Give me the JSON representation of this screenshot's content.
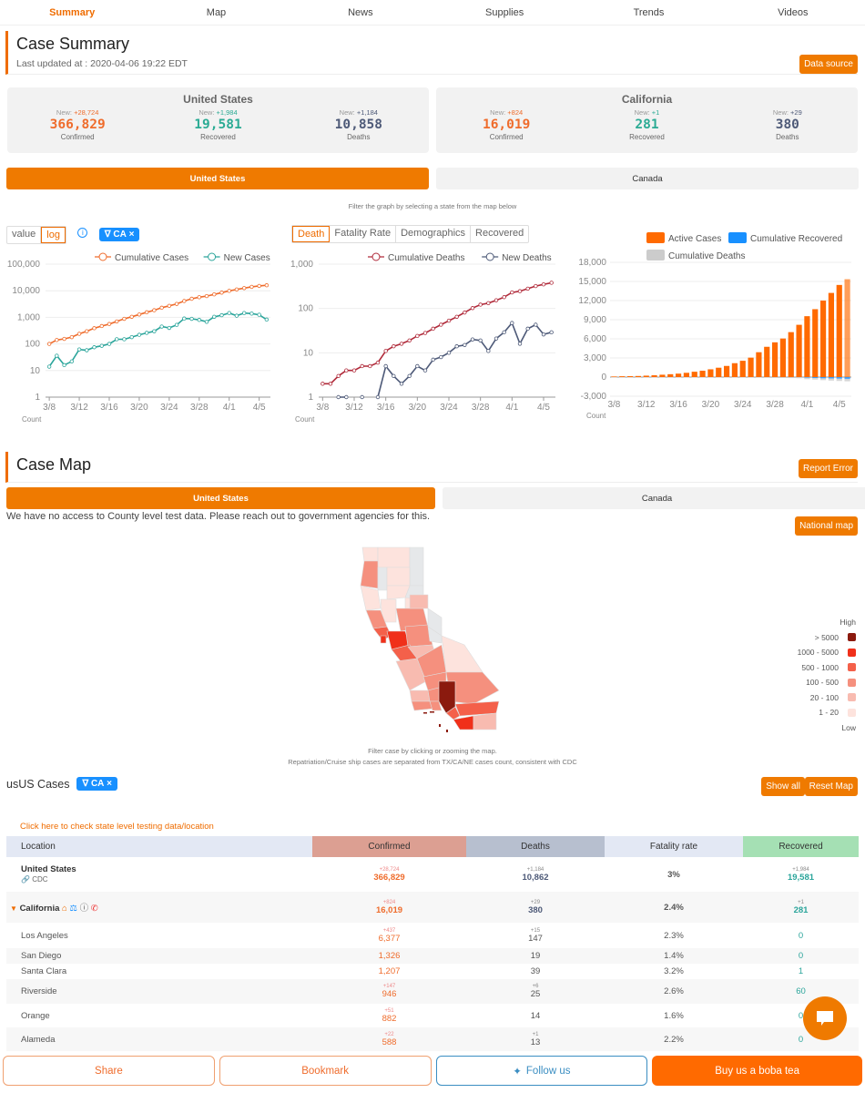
{
  "nav": {
    "tabs": [
      "Summary",
      "Map",
      "News",
      "Supplies",
      "Trends",
      "Videos"
    ],
    "active": "Summary"
  },
  "summary": {
    "title": "Case Summary",
    "last_updated": "Last updated at : 2020-04-06 19:22 EDT",
    "data_source_button": "Data source",
    "cards": [
      {
        "title": "United States",
        "stats": [
          {
            "new": "+28,724",
            "value": "366,829",
            "label": "Confirmed"
          },
          {
            "new": "+1,984",
            "value": "19,581",
            "label": "Recovered"
          },
          {
            "new": "+1,184",
            "value": "10,858",
            "label": "Deaths"
          }
        ]
      },
      {
        "title": "California",
        "stats": [
          {
            "new": "+824",
            "value": "16,019",
            "label": "Confirmed"
          },
          {
            "new": "+1",
            "value": "281",
            "label": "Recovered"
          },
          {
            "new": "+29",
            "value": "380",
            "label": "Deaths"
          }
        ]
      }
    ],
    "new_prefix": "New: "
  },
  "region_toggle": {
    "us": "United States",
    "canada": "Canada"
  },
  "graph_hint": "Filter the graph by selecting a state from the map below",
  "chart_controls": {
    "scale_options": [
      "value",
      "log"
    ],
    "scale_selected": "log",
    "filter_chip": "CA",
    "death_tabs": [
      "Death",
      "Fatality Rate",
      "Demographics",
      "Recovered"
    ],
    "death_tab_selected": "Death"
  },
  "colors": {
    "accent": "#ef7a00",
    "cumCases": "#ef6c2c",
    "newCases": "#2ba59b",
    "cumDeaths": "#b02a3a",
    "newDeaths": "#4e5a78",
    "active": "#ff6a00",
    "recovered": "#1890ff",
    "deaths": "#cccccc"
  },
  "chart_data": [
    {
      "type": "line",
      "title": "",
      "scale": "log",
      "xlabel": "",
      "ylabel": "Count",
      "x": [
        "3/8",
        "3/9",
        "3/10",
        "3/11",
        "3/12",
        "3/13",
        "3/14",
        "3/15",
        "3/16",
        "3/17",
        "3/18",
        "3/19",
        "3/20",
        "3/21",
        "3/22",
        "3/23",
        "3/24",
        "3/25",
        "3/26",
        "3/27",
        "3/28",
        "3/29",
        "3/30",
        "3/31",
        "4/1",
        "4/2",
        "4/3",
        "4/4",
        "4/5",
        "4/6"
      ],
      "xticks": [
        "3/8",
        "3/12",
        "3/16",
        "3/20",
        "3/24",
        "3/28",
        "4/1",
        "4/5"
      ],
      "yticks": [
        "1",
        "10",
        "100",
        "1,000",
        "10,000",
        "100,000"
      ],
      "ylim": [
        1,
        100000
      ],
      "legend": "top-right",
      "series": [
        {
          "name": "Cumulative Cases",
          "values": [
            100,
            140,
            155,
            180,
            240,
            300,
            390,
            470,
            560,
            700,
            880,
            1050,
            1280,
            1550,
            1850,
            2300,
            2700,
            3200,
            4100,
            5000,
            5700,
            6300,
            7300,
            8500,
            9900,
            11200,
            12600,
            14000,
            15200,
            16019
          ]
        },
        {
          "name": "New Cases",
          "values": [
            14,
            36,
            16,
            22,
            62,
            58,
            75,
            85,
            100,
            150,
            150,
            180,
            220,
            260,
            300,
            450,
            400,
            520,
            900,
            880,
            800,
            680,
            1050,
            1200,
            1450,
            1150,
            1450,
            1380,
            1250,
            824
          ]
        }
      ]
    },
    {
      "type": "line",
      "title": "",
      "scale": "log",
      "xlabel": "",
      "ylabel": "Count",
      "x": [
        "3/8",
        "3/9",
        "3/10",
        "3/11",
        "3/12",
        "3/13",
        "3/14",
        "3/15",
        "3/16",
        "3/17",
        "3/18",
        "3/19",
        "3/20",
        "3/21",
        "3/22",
        "3/23",
        "3/24",
        "3/25",
        "3/26",
        "3/27",
        "3/28",
        "3/29",
        "3/30",
        "3/31",
        "4/1",
        "4/2",
        "4/3",
        "4/4",
        "4/5",
        "4/6"
      ],
      "xticks": [
        "3/8",
        "3/12",
        "3/16",
        "3/20",
        "3/24",
        "3/28",
        "4/1",
        "4/5"
      ],
      "yticks": [
        "1",
        "10",
        "100",
        "1,000"
      ],
      "ylim": [
        1,
        1000
      ],
      "legend": "top-right",
      "series": [
        {
          "name": "Cumulative Deaths",
          "values": [
            2,
            2,
            3,
            4,
            4,
            5,
            5,
            6,
            11,
            14,
            16,
            19,
            24,
            28,
            35,
            43,
            53,
            65,
            81,
            102,
            122,
            132,
            153,
            180,
            230,
            245,
            280,
            320,
            350,
            380
          ]
        },
        {
          "name": "New Deaths",
          "values": [
            null,
            null,
            1,
            1,
            null,
            1,
            null,
            1,
            5,
            3,
            2,
            3,
            5,
            4,
            7,
            8,
            10,
            14,
            15,
            20,
            19,
            11,
            21,
            29,
            47,
            16,
            35,
            43,
            26,
            29
          ]
        }
      ]
    },
    {
      "type": "bar",
      "title": "",
      "stacked": true,
      "xlabel": "",
      "ylabel": "Count",
      "categories": [
        "3/8",
        "3/9",
        "3/10",
        "3/11",
        "3/12",
        "3/13",
        "3/14",
        "3/15",
        "3/16",
        "3/17",
        "3/18",
        "3/19",
        "3/20",
        "3/21",
        "3/22",
        "3/23",
        "3/24",
        "3/25",
        "3/26",
        "3/27",
        "3/28",
        "3/29",
        "3/30",
        "3/31",
        "4/1",
        "4/2",
        "4/3",
        "4/4",
        "4/5",
        "4/6"
      ],
      "xticks": [
        "3/8",
        "3/12",
        "3/16",
        "3/20",
        "3/24",
        "3/28",
        "4/1",
        "4/5"
      ],
      "yticks": [
        "-3,000",
        "0",
        "3,000",
        "6,000",
        "9,000",
        "12,000",
        "15,000",
        "18,000"
      ],
      "ylim": [
        -3000,
        18000
      ],
      "legend": "top-right",
      "series": [
        {
          "name": "Active Cases",
          "values": [
            95,
            130,
            145,
            170,
            225,
            285,
            370,
            450,
            540,
            670,
            840,
            1000,
            1220,
            1470,
            1750,
            2180,
            2560,
            3050,
            3900,
            4750,
            5450,
            6050,
            7050,
            8200,
            9550,
            10650,
            12000,
            13200,
            14450,
            15350
          ]
        },
        {
          "name": "Cumulative Recovered",
          "values": [
            0,
            0,
            0,
            0,
            0,
            0,
            0,
            0,
            0,
            0,
            0,
            0,
            0,
            0,
            0,
            0,
            0,
            0,
            0,
            0,
            0,
            0,
            0,
            0,
            -100,
            -150,
            -200,
            -230,
            -260,
            -281
          ]
        },
        {
          "name": "Cumulative Deaths",
          "values": [
            -2,
            -2,
            -3,
            -4,
            -4,
            -5,
            -5,
            -6,
            -11,
            -14,
            -16,
            -19,
            -24,
            -28,
            -35,
            -43,
            -53,
            -65,
            -81,
            -102,
            -122,
            -132,
            -153,
            -180,
            -230,
            -245,
            -280,
            -320,
            -350,
            -380
          ]
        }
      ]
    }
  ],
  "case_map": {
    "title": "Case Map",
    "report_error": "Report Error",
    "national_map": "National map",
    "notice": "We have no access to County level test data. Please reach out to government agencies for this.",
    "legend": {
      "high": "High",
      "low": "Low",
      "ranges": [
        {
          "label": "> 5000",
          "color": "#8b1a0e"
        },
        {
          "label": "1000 - 5000",
          "color": "#f0301a"
        },
        {
          "label": "500 - 1000",
          "color": "#f4604a"
        },
        {
          "label": "100 - 500",
          "color": "#f5907e"
        },
        {
          "label": "20 - 100",
          "color": "#f8bbb0"
        },
        {
          "label": "1 - 20",
          "color": "#fde3dd"
        }
      ]
    },
    "hint1": "Filter case by clicking or zooming the map.",
    "hint2": "Repatriation/Cruise ship cases are separated from TX/CA/NE cases count, consistent with CDC"
  },
  "us_cases": {
    "title": "usUS Cases",
    "chip": "CA",
    "show_all": "Show all",
    "reset_map": "Reset Map",
    "testing_link": "Click here to check state level testing data/location",
    "columns": [
      "Location",
      "Confirmed",
      "Deaths",
      "Fatality rate",
      "Recovered"
    ],
    "rows": [
      {
        "location": "United States",
        "sub": "CDC",
        "confirmed_new": "+28,724",
        "confirmed": "366,829",
        "deaths_new": "+1,184",
        "deaths": "10,862",
        "rate": "3%",
        "recovered_new": "+1,984",
        "recovered": "19,581"
      },
      {
        "location": "California",
        "confirmed_new": "+824",
        "confirmed": "16,019",
        "deaths_new": "+29",
        "deaths": "380",
        "rate": "2.4%",
        "recovered_new": "+1",
        "recovered": "281"
      },
      {
        "location": "Los Angeles",
        "confirmed_new": "+437",
        "confirmed": "6,377",
        "deaths_new": "+15",
        "deaths": "147",
        "rate": "2.3%",
        "recovered_new": "",
        "recovered": "0"
      },
      {
        "location": "San Diego",
        "confirmed_new": "",
        "confirmed": "1,326",
        "deaths_new": "",
        "deaths": "19",
        "rate": "1.4%",
        "recovered_new": "",
        "recovered": "0"
      },
      {
        "location": "Santa Clara",
        "confirmed_new": "",
        "confirmed": "1,207",
        "deaths_new": "",
        "deaths": "39",
        "rate": "3.2%",
        "recovered_new": "",
        "recovered": "1"
      },
      {
        "location": "Riverside",
        "confirmed_new": "+147",
        "confirmed": "946",
        "deaths_new": "+6",
        "deaths": "25",
        "rate": "2.6%",
        "recovered_new": "",
        "recovered": "60"
      },
      {
        "location": "Orange",
        "confirmed_new": "+51",
        "confirmed": "882",
        "deaths_new": "",
        "deaths": "14",
        "rate": "1.6%",
        "recovered_new": "",
        "recovered": "0"
      },
      {
        "location": "Alameda",
        "confirmed_new": "+22",
        "confirmed": "588",
        "deaths_new": "+1",
        "deaths": "13",
        "rate": "2.2%",
        "recovered_new": "",
        "recovered": "0"
      }
    ]
  },
  "bottom_bar": {
    "share": "Share",
    "bookmark": "Bookmark",
    "follow": "Follow us",
    "boba": "Buy us a boba tea"
  }
}
